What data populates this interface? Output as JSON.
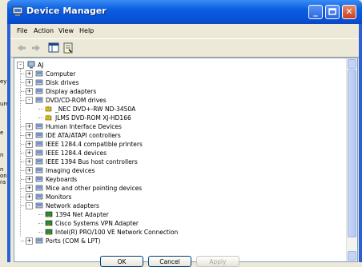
{
  "window": {
    "title": "Device Manager"
  },
  "menu": [
    "File",
    "Action",
    "View",
    "Help"
  ],
  "background_fragments": [
    "ey P",
    "ure",
    "e",
    "n",
    "n",
    "on",
    "ra"
  ],
  "tree": {
    "root": "AJ",
    "items": [
      {
        "label": "Computer",
        "level": 1,
        "expander": "+"
      },
      {
        "label": "Disk drives",
        "level": 1,
        "expander": "+"
      },
      {
        "label": "Display adapters",
        "level": 1,
        "expander": "+"
      },
      {
        "label": "DVD/CD-ROM drives",
        "level": 1,
        "expander": "-"
      },
      {
        "label": "_NEC DVD+-RW ND-3450A",
        "level": 2,
        "expander": "",
        "warning": true
      },
      {
        "label": "JLMS DVD-ROM XJ-HD166",
        "level": 2,
        "expander": "",
        "warning": true
      },
      {
        "label": "Human Interface Devices",
        "level": 1,
        "expander": "+"
      },
      {
        "label": "IDE ATA/ATAPI controllers",
        "level": 1,
        "expander": "+"
      },
      {
        "label": "IEEE 1284.4 compatible printers",
        "level": 1,
        "expander": "+"
      },
      {
        "label": "IEEE 1284.4 devices",
        "level": 1,
        "expander": "+"
      },
      {
        "label": "IEEE 1394 Bus host controllers",
        "level": 1,
        "expander": "+"
      },
      {
        "label": "Imaging devices",
        "level": 1,
        "expander": "+"
      },
      {
        "label": "Keyboards",
        "level": 1,
        "expander": "+"
      },
      {
        "label": "Mice and other pointing devices",
        "level": 1,
        "expander": "+"
      },
      {
        "label": "Monitors",
        "level": 1,
        "expander": "+"
      },
      {
        "label": "Network adapters",
        "level": 1,
        "expander": "-"
      },
      {
        "label": "1394 Net Adapter",
        "level": 2,
        "expander": ""
      },
      {
        "label": "Cisco Systems VPN Adapter",
        "level": 2,
        "expander": ""
      },
      {
        "label": "Intel(R) PRO/100 VE Network Connection",
        "level": 2,
        "expander": ""
      },
      {
        "label": "Ports (COM & LPT)",
        "level": 1,
        "expander": "+"
      }
    ]
  },
  "buttons": {
    "ok": "OK",
    "cancel": "Cancel",
    "apply": "Apply"
  },
  "colors": {
    "titlebar": "#0a5fe0",
    "close": "#c8401e",
    "warning": "#f5d300"
  }
}
